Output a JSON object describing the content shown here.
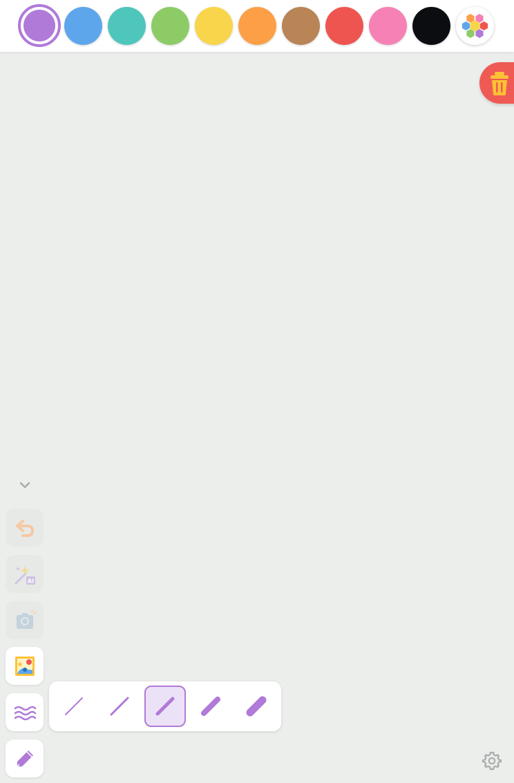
{
  "palette": {
    "colors": [
      {
        "name": "purple",
        "hex": "#b07ad8",
        "selected": true
      },
      {
        "name": "blue",
        "hex": "#5ea6ec",
        "selected": false
      },
      {
        "name": "teal",
        "hex": "#4fc6bc",
        "selected": false
      },
      {
        "name": "green",
        "hex": "#8dcb67",
        "selected": false
      },
      {
        "name": "yellow",
        "hex": "#f9d54b",
        "selected": false
      },
      {
        "name": "orange",
        "hex": "#fd9f46",
        "selected": false
      },
      {
        "name": "brown",
        "hex": "#b98456",
        "selected": false
      },
      {
        "name": "red",
        "hex": "#ef5550",
        "selected": false
      },
      {
        "name": "pink",
        "hex": "#f681b4",
        "selected": false
      },
      {
        "name": "black",
        "hex": "#0c0d10",
        "selected": false
      }
    ],
    "more_colors_icon": "hexagon-palette-icon"
  },
  "canvas": {
    "background": "#eceeec"
  },
  "actions": {
    "clear_icon": "trash-icon",
    "collapse_icon": "chevron-down-icon",
    "settings_icon": "gear-icon"
  },
  "toolbar": {
    "tools": [
      {
        "name": "undo",
        "icon": "undo-icon",
        "enabled": false
      },
      {
        "name": "ai-magic",
        "icon": "magic-wand-ai-icon",
        "enabled": false
      },
      {
        "name": "camera",
        "icon": "camera-icon",
        "enabled": false
      },
      {
        "name": "sticker",
        "icon": "sticker-picture-icon",
        "enabled": true
      },
      {
        "name": "brush-style",
        "icon": "wavy-lines-icon",
        "enabled": true
      },
      {
        "name": "pen",
        "icon": "pen-icon",
        "enabled": true
      }
    ]
  },
  "brush_sizes": {
    "options": [
      {
        "size": "extra-thin",
        "selected": false
      },
      {
        "size": "thin",
        "selected": false
      },
      {
        "size": "medium",
        "selected": true
      },
      {
        "size": "thick",
        "selected": false
      },
      {
        "size": "extra-thick",
        "selected": false
      }
    ],
    "color": "#b07ad8"
  }
}
